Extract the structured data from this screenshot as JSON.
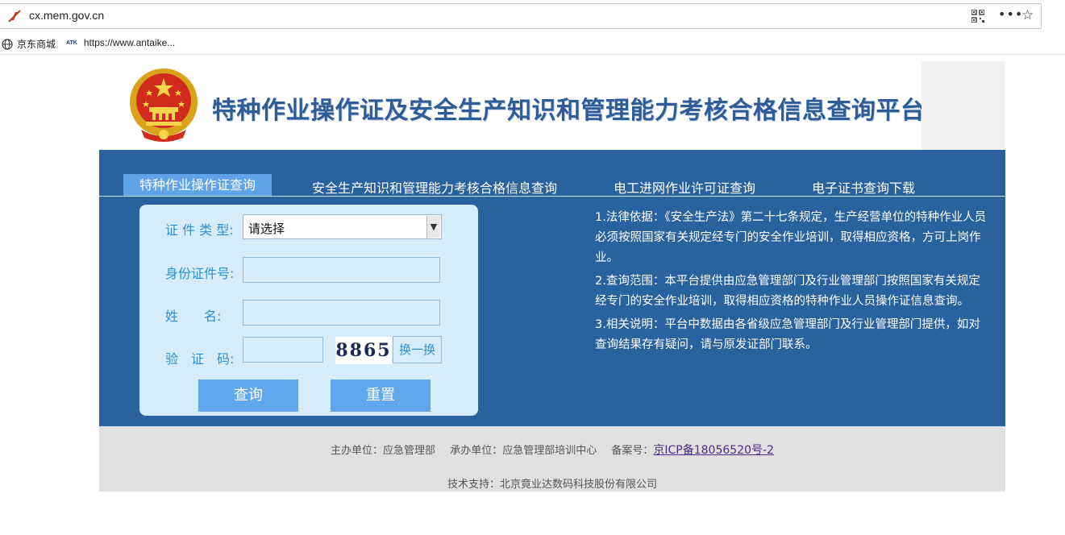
{
  "browser": {
    "url": "cx.mem.gov.cn",
    "bookmarks": [
      {
        "label": "京东商城",
        "icon": "globe-icon"
      },
      {
        "label": "https://www.antaike...",
        "icon": "atk-icon",
        "badge": "ATK"
      }
    ],
    "icons": [
      "blocked-flash-icon",
      "qr-code-icon",
      "more-icon",
      "star-icon"
    ]
  },
  "header": {
    "title": "特种作业操作证及安全生产知识和管理能力考核合格信息查询平台"
  },
  "tabs": [
    {
      "label": "特种作业操作证查询",
      "active": true
    },
    {
      "label": "安全生产知识和管理能力考核合格信息查询",
      "active": false
    },
    {
      "label": "电工进网作业许可证查询",
      "active": false
    },
    {
      "label": "电子证书查询下载",
      "active": false
    }
  ],
  "form": {
    "cert_type_label": "证 件 类 型:",
    "cert_type_value": "请选择",
    "id_label": "身份证件号:",
    "id_value": "",
    "name_label": "姓　　名:",
    "name_value": "",
    "captcha_label": "验　证　码:",
    "captcha_value": "",
    "captcha_image_text": "8865",
    "refresh_label": "换一换",
    "query_button": "查询",
    "reset_button": "重置"
  },
  "info": [
    "1.法律依据：《安全生产法》第二十七条规定，生产经营单位的特种作业人员必须按照国家有关规定经专门的安全作业培训，取得相应资格，方可上岗作业。",
    "2.查询范围：本平台提供由应急管理部门及行业管理部门按照国家有关规定经专门的安全作业培训，取得相应资格的特种作业人员操作证信息查询。",
    "3.相关说明：平台中数据由各省级应急管理部门及行业管理部门提供，如对查询结果存有疑问，请与原发证部门联系。"
  ],
  "footer": {
    "host": "主办单位：应急管理部",
    "organizer": "承办单位：应急管理部培训中心",
    "icp_label": "备案号：",
    "icp_link": "京ICP备18056520号-2",
    "support": "技术支持：北京竟业达数码科技股份有限公司"
  },
  "colors": {
    "primary_blue": "#2a62a0",
    "tab_active": "#5fa4e8",
    "form_bg": "#d6ecfb",
    "button": "#5fa8ee",
    "title": "#2e5c97"
  }
}
